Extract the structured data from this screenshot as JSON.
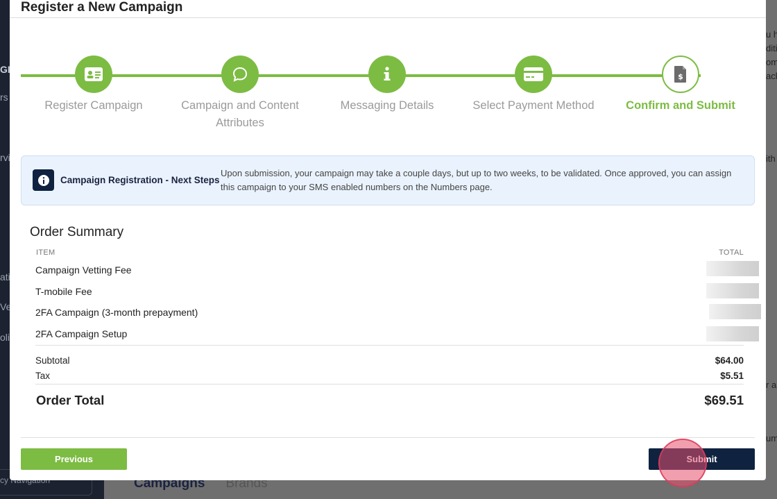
{
  "background": {
    "left_fragments": [
      "GIO",
      "rs",
      "rvi",
      "atio",
      "Ver",
      "olic"
    ],
    "right_fragments": [
      "u h",
      "diti",
      "omi",
      "ack",
      "ith",
      "r a",
      "um"
    ],
    "tabs": [
      "Campaigns",
      "Brands"
    ],
    "nav_text": "cy Navigation"
  },
  "modal": {
    "title": "Register a New Campaign",
    "steps": [
      {
        "label": "Register Campaign",
        "icon": "id-card-icon",
        "state": "complete"
      },
      {
        "label": "Campaign and Content Attributes",
        "icon": "speech-bubble-icon",
        "state": "complete"
      },
      {
        "label": "Messaging Details",
        "icon": "info-icon",
        "state": "complete"
      },
      {
        "label": "Select Payment Method",
        "icon": "credit-card-icon",
        "state": "complete"
      },
      {
        "label": "Confirm and Submit",
        "icon": "invoice-dollar-icon",
        "state": "active"
      }
    ],
    "banner": {
      "title": "Campaign Registration - Next Steps",
      "text": "Upon submission, your campaign may take a couple days, but up to two weeks, to be validated. Once approved, you can assign this campaign to your SMS enabled numbers on the Numbers page."
    },
    "order_summary": {
      "title": "Order Summary",
      "col_item": "ITEM",
      "col_total": "TOTAL",
      "items": [
        "Campaign Vetting Fee",
        "T-mobile Fee",
        "2FA Campaign (3-month prepayment)",
        "2FA Campaign Setup"
      ],
      "subtotal_label": "Subtotal",
      "subtotal_value": "$64.00",
      "tax_label": "Tax",
      "tax_value": "$5.51",
      "total_label": "Order Total",
      "total_value": "$69.51"
    },
    "buttons": {
      "previous": "Previous",
      "submit": "Submit"
    }
  },
  "colors": {
    "accent_green": "#7cbc43",
    "navy": "#0f2340",
    "banner_bg": "#eaf3fd"
  }
}
